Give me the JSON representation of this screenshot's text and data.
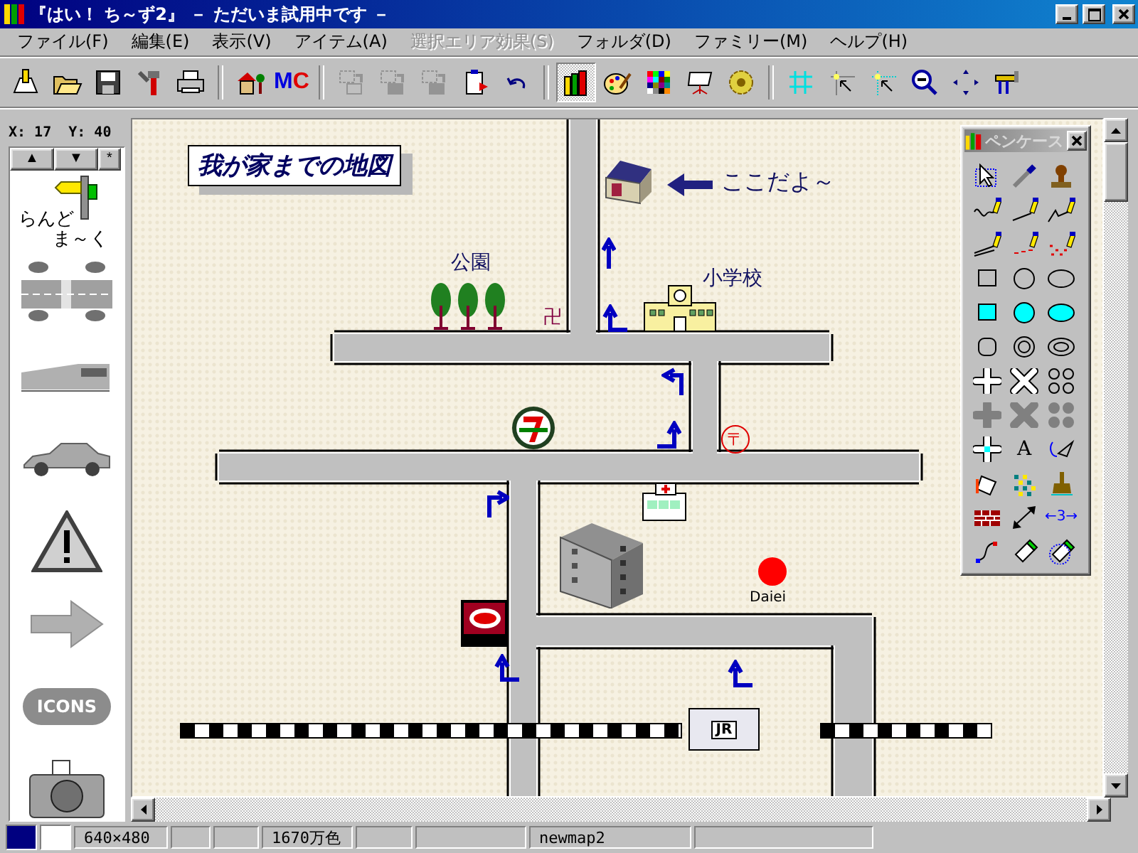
{
  "window": {
    "title": "『はい！ ち～ず2』 － ただいま試用中です －"
  },
  "menu": [
    {
      "label": "ファイル(F)",
      "disabled": false
    },
    {
      "label": "編集(E)",
      "disabled": false
    },
    {
      "label": "表示(V)",
      "disabled": false
    },
    {
      "label": "アイテム(A)",
      "disabled": false
    },
    {
      "label": "選択エリア効果(S)",
      "disabled": true
    },
    {
      "label": "フォルダ(D)",
      "disabled": false
    },
    {
      "label": "ファミリー(M)",
      "disabled": false
    },
    {
      "label": "ヘルプ(H)",
      "disabled": false
    }
  ],
  "toolbar": [
    {
      "kind": "new",
      "disabled": false,
      "pressed": false
    },
    {
      "kind": "open",
      "disabled": false,
      "pressed": false
    },
    {
      "kind": "save",
      "disabled": false,
      "pressed": false
    },
    {
      "kind": "tools",
      "disabled": false,
      "pressed": false
    },
    {
      "kind": "print",
      "disabled": false,
      "pressed": false
    },
    {
      "kind": "sep"
    },
    {
      "kind": "landmark",
      "disabled": false,
      "pressed": false
    },
    {
      "kind": "mc",
      "disabled": false,
      "pressed": false,
      "parts": [
        "M",
        "C"
      ]
    },
    {
      "kind": "sep"
    },
    {
      "kind": "copy",
      "disabled": true,
      "pressed": false
    },
    {
      "kind": "cut",
      "disabled": true,
      "pressed": false
    },
    {
      "kind": "paste",
      "disabled": true,
      "pressed": false
    },
    {
      "kind": "clipboard",
      "disabled": false,
      "pressed": false
    },
    {
      "kind": "undo",
      "disabled": false,
      "pressed": false
    },
    {
      "kind": "sep"
    },
    {
      "kind": "pencase",
      "disabled": false,
      "pressed": true
    },
    {
      "kind": "paint",
      "disabled": false,
      "pressed": false
    },
    {
      "kind": "colors",
      "disabled": false,
      "pressed": false
    },
    {
      "kind": "easel",
      "disabled": false,
      "pressed": false
    },
    {
      "kind": "gear",
      "disabled": false,
      "pressed": false
    },
    {
      "kind": "sep"
    },
    {
      "kind": "grid",
      "disabled": false,
      "pressed": false
    },
    {
      "kind": "snap",
      "disabled": false,
      "pressed": false
    },
    {
      "kind": "snap2",
      "disabled": false,
      "pressed": false
    },
    {
      "kind": "zoom",
      "disabled": false,
      "pressed": false
    },
    {
      "kind": "move",
      "disabled": false,
      "pressed": false
    },
    {
      "kind": "tool2",
      "disabled": false,
      "pressed": false
    }
  ],
  "coords": {
    "x": "X:  17",
    "y": "Y:  40"
  },
  "library": {
    "buttons": [
      "▲",
      "▼",
      "*"
    ],
    "items": [
      {
        "kind": "landmark",
        "lines": [
          "らんど",
          "ま～く"
        ]
      },
      {
        "kind": "road"
      },
      {
        "kind": "train"
      },
      {
        "kind": "car"
      },
      {
        "kind": "warning"
      },
      {
        "kind": "arrow"
      },
      {
        "kind": "icons",
        "label": "ICONS"
      },
      {
        "kind": "camera"
      }
    ]
  },
  "map": {
    "title": "我が家までの地図",
    "items": [
      {
        "kind": "house"
      },
      {
        "kind": "big-arrow"
      },
      {
        "kind": "label",
        "text": "ここだよ～"
      },
      {
        "kind": "label",
        "text": "公園"
      },
      {
        "kind": "trees"
      },
      {
        "kind": "symbol",
        "text": "卍",
        "color": "#800040"
      },
      {
        "kind": "arrow-up"
      },
      {
        "kind": "arrow-up-right"
      },
      {
        "kind": "school"
      },
      {
        "kind": "label",
        "text": "小学校"
      },
      {
        "kind": "arrow-left-down"
      },
      {
        "kind": "arrow-left-up"
      },
      {
        "kind": "store"
      },
      {
        "kind": "post",
        "text": "〒"
      },
      {
        "kind": "arrow-right-down"
      },
      {
        "kind": "hospital"
      },
      {
        "kind": "building"
      },
      {
        "kind": "dot",
        "color": "#ff0000"
      },
      {
        "kind": "small-label",
        "text": "Daiei"
      },
      {
        "kind": "gas"
      },
      {
        "kind": "arrow-up-right"
      },
      {
        "kind": "arrow-up-left"
      },
      {
        "kind": "station",
        "text": "JR"
      }
    ]
  },
  "pencase": {
    "title": "ペンケース",
    "active": false,
    "tools": [
      {
        "kind": "select",
        "selected": false
      },
      {
        "kind": "pipette",
        "selected": false
      },
      {
        "kind": "stamp",
        "selected": false
      },
      {
        "kind": "freehand",
        "selected": false
      },
      {
        "kind": "line",
        "selected": false
      },
      {
        "kind": "polyline",
        "selected": false
      },
      {
        "kind": "multiline",
        "selected": false
      },
      {
        "kind": "dots",
        "selected": false
      },
      {
        "kind": "scatter",
        "selected": false
      },
      {
        "kind": "rect",
        "selected": false
      },
      {
        "kind": "circle",
        "selected": false
      },
      {
        "kind": "ellipse",
        "selected": false
      },
      {
        "kind": "rect-fill",
        "selected": false
      },
      {
        "kind": "circle-fill",
        "selected": false
      },
      {
        "kind": "ellipse-fill",
        "selected": false
      },
      {
        "kind": "round-rect",
        "selected": false
      },
      {
        "kind": "ring",
        "selected": false
      },
      {
        "kind": "ellipse-ring",
        "selected": false
      },
      {
        "kind": "cross",
        "selected": false
      },
      {
        "kind": "x",
        "selected": false
      },
      {
        "kind": "quad",
        "selected": false
      },
      {
        "kind": "cross-grey",
        "selected": false
      },
      {
        "kind": "x-grey",
        "selected": false
      },
      {
        "kind": "quad-grey",
        "selected": false
      },
      {
        "kind": "cross-cyan",
        "selected": false
      },
      {
        "kind": "text",
        "label": "A",
        "selected": false
      },
      {
        "kind": "rotate",
        "selected": false
      },
      {
        "kind": "bucket",
        "selected": false
      },
      {
        "kind": "spray",
        "selected": false
      },
      {
        "kind": "brush",
        "selected": false
      },
      {
        "kind": "brick",
        "selected": false
      },
      {
        "kind": "diagonal",
        "selected": false
      },
      {
        "kind": "dimension",
        "label": "←3→",
        "selected": false
      },
      {
        "kind": "curve",
        "selected": false
      },
      {
        "kind": "eraser",
        "selected": false
      },
      {
        "kind": "eraser2",
        "selected": false
      }
    ]
  },
  "status_bar": {
    "color_swatches": [
      {
        "color": "#000080"
      },
      {
        "color": "#ffffff"
      }
    ],
    "size": "640×480",
    "depth": "1670万色",
    "file": "newmap2"
  }
}
